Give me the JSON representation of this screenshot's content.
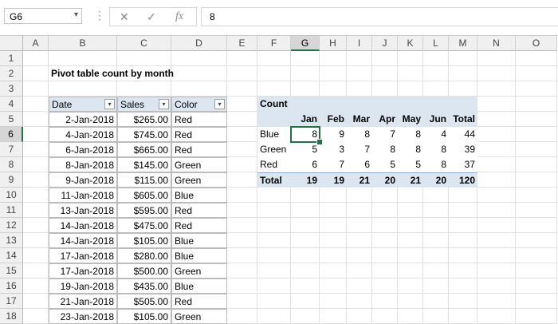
{
  "formula_bar": {
    "name_box": "G6",
    "cancel_icon": "✕",
    "enter_icon": "✓",
    "fx_icon": "fx",
    "formula_value": "8"
  },
  "columns": [
    "A",
    "B",
    "C",
    "D",
    "E",
    "F",
    "G",
    "H",
    "I",
    "J",
    "K",
    "L",
    "M",
    "N",
    "O"
  ],
  "rows": [
    "1",
    "2",
    "3",
    "4",
    "5",
    "6",
    "7",
    "8",
    "9",
    "10",
    "11",
    "12",
    "13",
    "14",
    "15",
    "16",
    "17",
    "18"
  ],
  "selected": {
    "cell": "G6",
    "column": "G",
    "row": "6"
  },
  "colors": {
    "accent": "#217346",
    "table_header": "#dce6f1"
  },
  "sheet": {
    "title": "Pivot table count by month",
    "source_table": {
      "headers": [
        "Date",
        "Sales",
        "Color"
      ],
      "filter_icon": "▾",
      "rows": [
        [
          "2-Jan-2018",
          "$265.00",
          "Red"
        ],
        [
          "4-Jan-2018",
          "$745.00",
          "Red"
        ],
        [
          "6-Jan-2018",
          "$665.00",
          "Red"
        ],
        [
          "8-Jan-2018",
          "$145.00",
          "Green"
        ],
        [
          "9-Jan-2018",
          "$115.00",
          "Green"
        ],
        [
          "11-Jan-2018",
          "$605.00",
          "Blue"
        ],
        [
          "13-Jan-2018",
          "$595.00",
          "Red"
        ],
        [
          "14-Jan-2018",
          "$475.00",
          "Red"
        ],
        [
          "14-Jan-2018",
          "$105.00",
          "Blue"
        ],
        [
          "17-Jan-2018",
          "$280.00",
          "Blue"
        ],
        [
          "17-Jan-2018",
          "$500.00",
          "Green"
        ],
        [
          "19-Jan-2018",
          "$435.00",
          "Blue"
        ],
        [
          "21-Jan-2018",
          "$505.00",
          "Red"
        ],
        [
          "23-Jan-2018",
          "$105.00",
          "Green"
        ]
      ]
    },
    "pivot": {
      "label": "Count",
      "months": [
        "Jan",
        "Feb",
        "Mar",
        "Apr",
        "May",
        "Jun"
      ],
      "total_label": "Total",
      "rows": [
        {
          "label": "Blue",
          "values": [
            "8",
            "9",
            "8",
            "7",
            "8",
            "4"
          ],
          "total": "44"
        },
        {
          "label": "Green",
          "values": [
            "5",
            "3",
            "7",
            "8",
            "8",
            "8"
          ],
          "total": "39"
        },
        {
          "label": "Red",
          "values": [
            "6",
            "7",
            "6",
            "5",
            "5",
            "8"
          ],
          "total": "37"
        }
      ],
      "grand_total": {
        "label": "Total",
        "values": [
          "19",
          "19",
          "21",
          "20",
          "21",
          "20"
        ],
        "total": "120"
      }
    }
  }
}
